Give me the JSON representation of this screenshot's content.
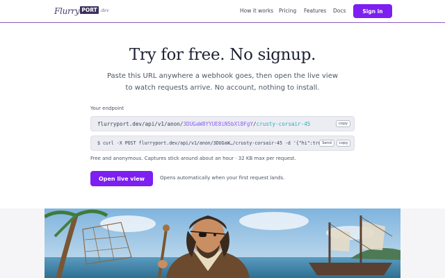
{
  "header": {
    "logo": {
      "script": "Flurry",
      "badge": "PORT",
      "tld": ".dev"
    },
    "nav": [
      "How it works",
      "Pricing",
      "Features",
      "Docs"
    ],
    "signin_label": "Sign in",
    "accent": "#7c1ff0"
  },
  "hero": {
    "title": "Try for free. No signup.",
    "subtitle_line1": "Paste this URL anywhere a webhook goes, then open the live view",
    "subtitle_line2": "to watch requests arrive. No account, nothing to install."
  },
  "endpoint": {
    "label": "Your endpoint",
    "url_prefix": "flurryport.dev/api/v1/anon/",
    "url_id": "3DUGaW8YYUE8iN5bXlBFgY",
    "url_sep": "/",
    "url_slug": "crusty-corsair-45",
    "copy_label": "copy",
    "curl": "$ curl -X POST flurryport.dev/api/v1/anon/3DUGaW…/crusty-corsair-45 -d '{\"hi\":tru",
    "send_label": "Send",
    "copy2_label": "copy",
    "note": "Free and anonymous. Captures stick around about an hour · 32 KB max per request."
  },
  "cta": {
    "open_label": "Open live view",
    "hint": "Opens automatically when your first request lands."
  },
  "illustration": {
    "icon": "pirate-illustration"
  }
}
